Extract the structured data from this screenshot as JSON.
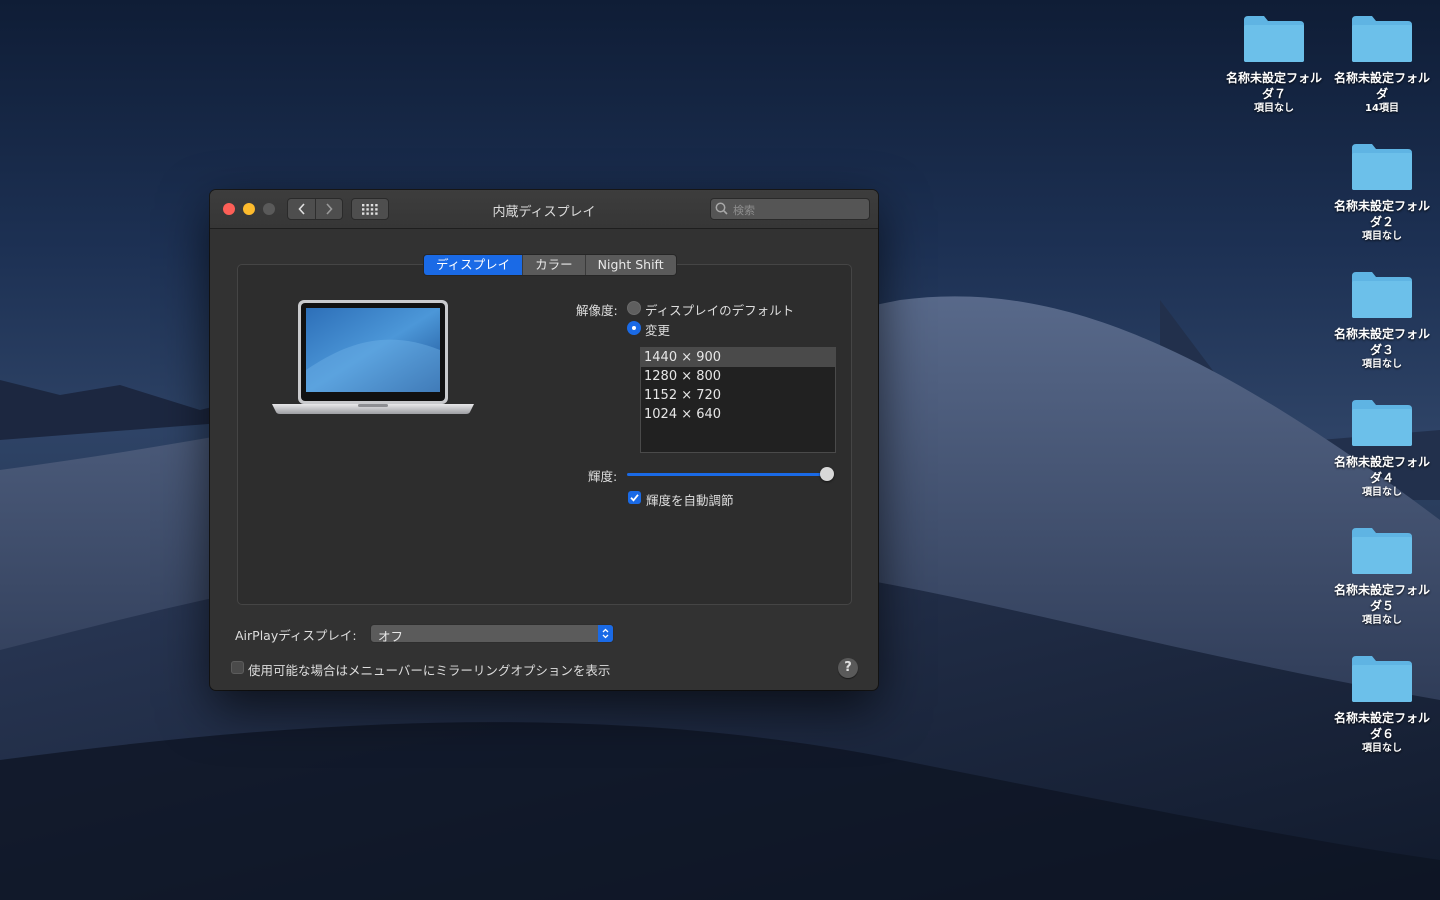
{
  "window": {
    "title": "内蔵ディスプレイ",
    "search_placeholder": "検索",
    "tabs": [
      {
        "label": "ディスプレイ",
        "active": true
      },
      {
        "label": "カラー",
        "active": false
      },
      {
        "label": "Night Shift",
        "active": false
      }
    ],
    "resolution_label": "解像度:",
    "resolution_options": [
      {
        "label": "ディスプレイのデフォルト",
        "selected": false
      },
      {
        "label": "変更",
        "selected": true
      }
    ],
    "resolutions": [
      {
        "label": "1440 × 900",
        "selected": true
      },
      {
        "label": "1280 × 800",
        "selected": false
      },
      {
        "label": "1152 × 720",
        "selected": false
      },
      {
        "label": "1024 × 640",
        "selected": false
      }
    ],
    "brightness_label": "輝度:",
    "brightness_value": 1.0,
    "auto_brightness_label": "輝度を自動調節",
    "auto_brightness_checked": true,
    "airplay_label": "AirPlayディスプレイ:",
    "airplay_value": "オフ",
    "mirroring_label": "使用可能な場合はメニューバーにミラーリングオプションを表示",
    "mirroring_checked": false,
    "help_label": "?"
  },
  "desktop_icons": [
    {
      "name": "名称未設定フォルダ７",
      "sub": "項目なし"
    },
    {
      "name": "名称未設定フォルダ",
      "sub": "14項目"
    },
    {
      "name": "名称未設定フォルダ２",
      "sub": "項目なし"
    },
    {
      "name": "名称未設定フォルダ３",
      "sub": "項目なし"
    },
    {
      "name": "名称未設定フォルダ４",
      "sub": "項目なし"
    },
    {
      "name": "名称未設定フォルダ５",
      "sub": "項目なし"
    },
    {
      "name": "名称未設定フォルダ６",
      "sub": "項目なし"
    }
  ],
  "colors": {
    "accent": "#1a6ae6",
    "folder": "#5fb4e3",
    "close": "#fd5f57",
    "minimize": "#fdbb2d"
  }
}
